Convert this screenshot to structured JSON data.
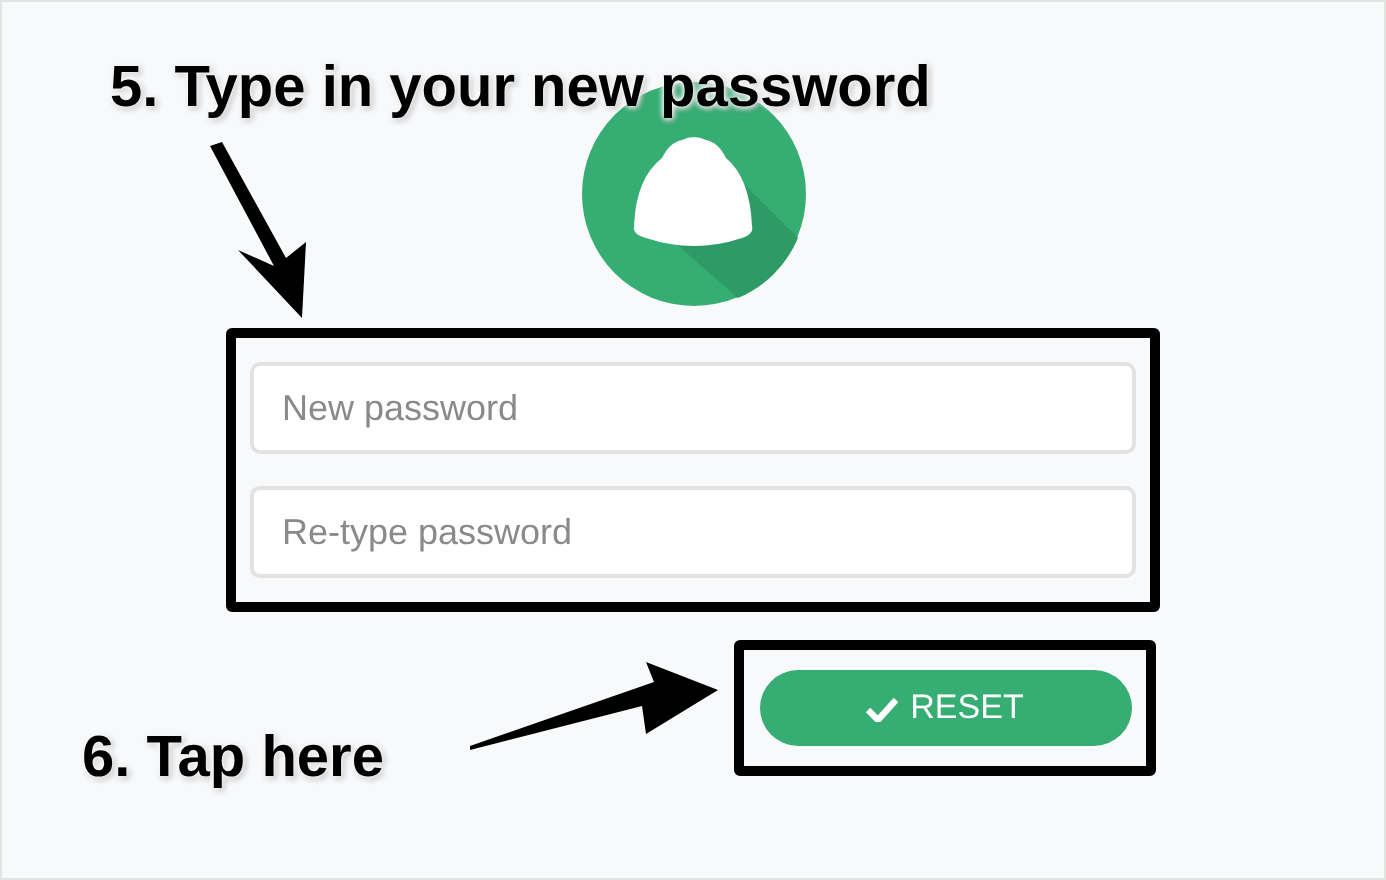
{
  "annotations": [
    {
      "text": "5. Type in your new password"
    },
    {
      "text": "6. Tap here"
    }
  ],
  "form": {
    "fields": [
      {
        "placeholder": "New password"
      },
      {
        "placeholder": "Re-type password"
      }
    ],
    "submit_button": {
      "label": "RESET"
    }
  }
}
